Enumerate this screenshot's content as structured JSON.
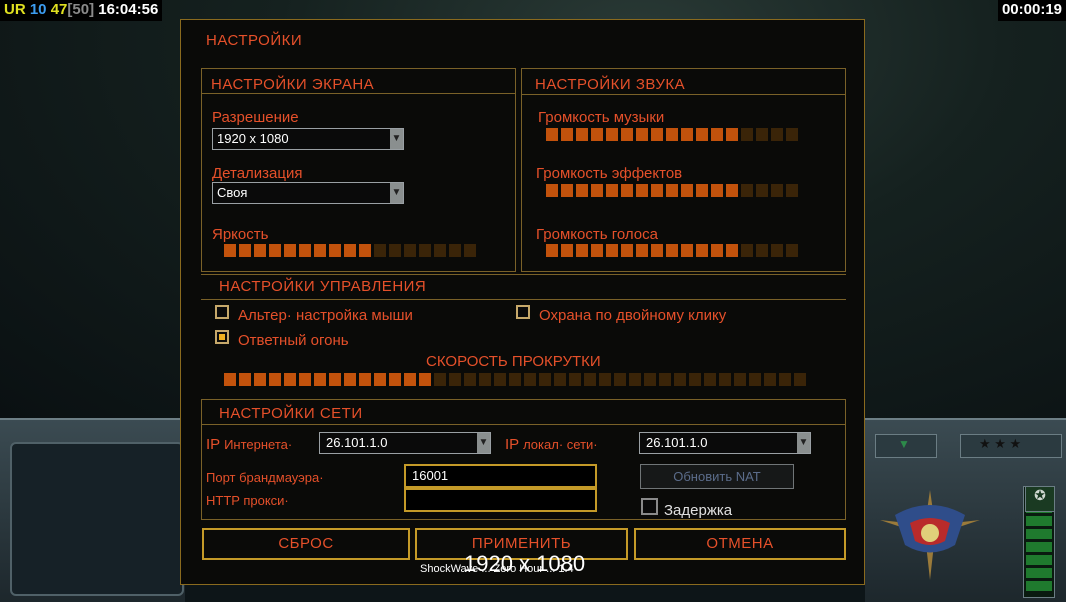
{
  "hud": {
    "stats": {
      "ur": "UR",
      "v1": "10",
      "v2": "47",
      "v3": "[50]",
      "clock": "16:04:56"
    },
    "timer": "00:00:19"
  },
  "settings": {
    "title": "НАСТРОЙКИ",
    "screen": {
      "heading": "НАСТРОЙКИ ЭКРАНА",
      "resolution_label": "Разрешение",
      "resolution_value": "1920 x 1080",
      "detail_label": "Детализация",
      "detail_value": "Своя",
      "brightness_label": "Яркость",
      "brightness_level": 0.6
    },
    "sound": {
      "heading": "НАСТРОЙКИ ЗВУКА",
      "music_label": "Громкость музыки",
      "music_level": 0.75,
      "effects_label": "Громкость эффектов",
      "effects_level": 0.75,
      "voice_label": "Громкость голоса",
      "voice_level": 0.75
    },
    "control": {
      "heading": "НАСТРОЙКИ УПРАВЛЕНИЯ",
      "alt_mouse_label": "Альтер· настройка мыши",
      "alt_mouse_checked": false,
      "double_click_guard_label": "Охрана по двойному клику",
      "double_click_guard_checked": false,
      "return_fire_label": "Ответный огонь",
      "return_fire_checked": true,
      "scroll_speed_label": "СКОРОСТЬ ПРОКРУТКИ",
      "scroll_speed_level": 0.37
    },
    "network": {
      "heading": "НАСТРОЙКИ СЕТИ",
      "internet_ip_label_prefix": "IP",
      "internet_ip_label": "Интернета·",
      "internet_ip_value": "26.101.1.0",
      "lan_ip_label_prefix": "IP",
      "lan_ip_label": "локал· сети·",
      "lan_ip_value": "26.101.1.0",
      "firewall_port_label": "Порт брандмауэра·",
      "firewall_port_value": "16001",
      "http_proxy_label": "HTTP прокси·",
      "http_proxy_value": "",
      "update_nat_label": "Обновить NAT",
      "delay_label": "Задержка",
      "delay_checked": false
    },
    "buttons": {
      "reset": "СБРОС",
      "apply": "ПРИМЕНИТЬ",
      "cancel": "ОТМЕНА"
    }
  },
  "footer": {
    "version_text": "ShockWave ... Zero Hour ... 1.4",
    "resolution_overlay": "1920 x 1080"
  }
}
